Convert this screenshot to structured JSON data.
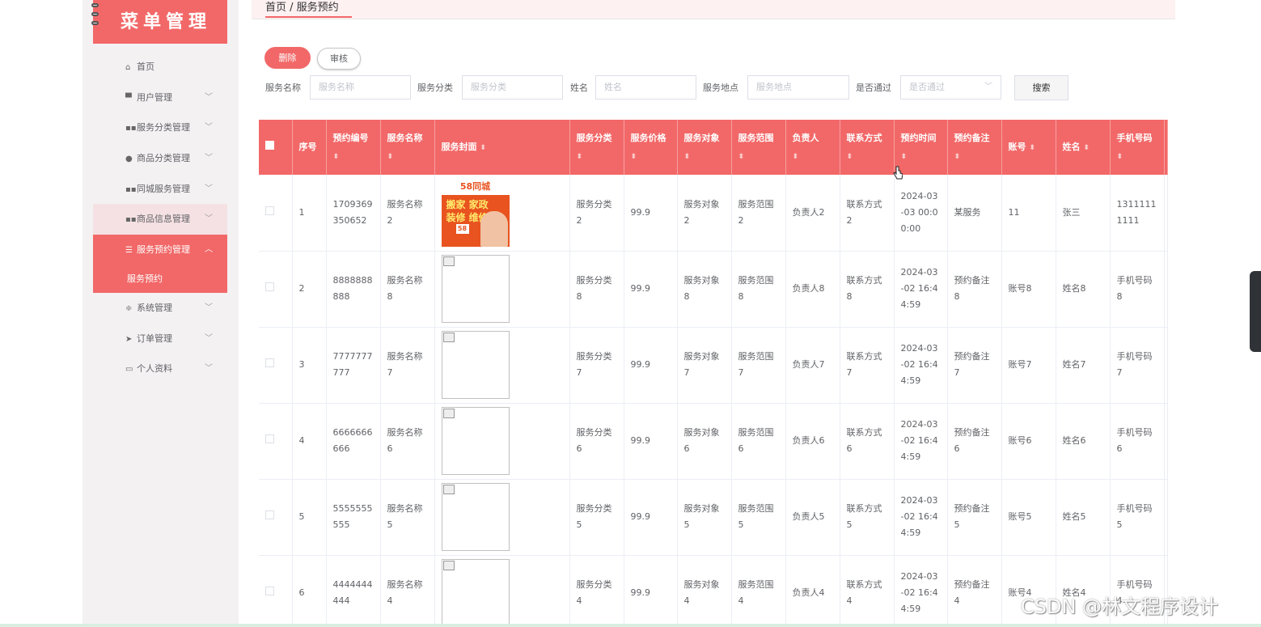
{
  "sidebar": {
    "logo_text": "菜单管理",
    "items": [
      {
        "label": "首页",
        "icon": "home-icon",
        "has_chevron": false
      },
      {
        "label": "用户管理",
        "icon": "monitor-icon",
        "has_chevron": true
      },
      {
        "label": "服务分类管理",
        "icon": "grid-icon",
        "has_chevron": true
      },
      {
        "label": "商品分类管理",
        "icon": "user-icon",
        "has_chevron": true
      },
      {
        "label": "同城服务管理",
        "icon": "grid-icon",
        "has_chevron": true
      },
      {
        "label": "商品信息管理",
        "icon": "grid-icon",
        "has_chevron": true
      },
      {
        "label": "服务预约管理",
        "icon": "list-icon",
        "has_chevron": true
      },
      {
        "label": "系统管理",
        "icon": "sliders-icon",
        "has_chevron": true
      },
      {
        "label": "订单管理",
        "icon": "send-icon",
        "has_chevron": true
      },
      {
        "label": "个人资料",
        "icon": "card-icon",
        "has_chevron": true
      }
    ],
    "sub_item": "服务预约"
  },
  "breadcrumb": "首页 / 服务预约",
  "actions": {
    "delete": "删除",
    "audit": "审核",
    "search": "搜索"
  },
  "filters": {
    "service_name": {
      "label": "服务名称",
      "placeholder": "服务名称"
    },
    "service_category": {
      "label": "服务分类",
      "placeholder": "服务分类"
    },
    "name": {
      "label": "姓名",
      "placeholder": "姓名"
    },
    "service_location": {
      "label": "服务地点",
      "placeholder": "服务地点"
    },
    "approved": {
      "label": "是否通过",
      "placeholder": "是否通过"
    }
  },
  "table": {
    "columns": [
      "序号",
      "预约编号",
      "服务名称",
      "服务封面",
      "服务分类",
      "服务价格",
      "服务对象",
      "服务范围",
      "负责人",
      "联系方式",
      "预约时间",
      "预约备注",
      "账号",
      "姓名",
      "手机号码"
    ],
    "rows": [
      {
        "index": "1",
        "booking_no": "1709369350652",
        "service_name": "服务名称2",
        "cover": "58同城 搬家 家政 装修 维修",
        "category": "服务分类2",
        "price": "99.9",
        "target": "服务对象2",
        "scope": "服务范围2",
        "manager": "负责人2",
        "contact": "联系方式2",
        "time": "2024-03-03 00:00:00",
        "remark": "某服务",
        "account": "11",
        "name": "张三",
        "phone": "13111111111"
      },
      {
        "index": "2",
        "booking_no": "8888888888",
        "service_name": "服务名称8",
        "cover": "",
        "category": "服务分类8",
        "price": "99.9",
        "target": "服务对象8",
        "scope": "服务范围8",
        "manager": "负责人8",
        "contact": "联系方式8",
        "time": "2024-03-02 16:44:59",
        "remark": "预约备注8",
        "account": "账号8",
        "name": "姓名8",
        "phone": "手机号码8"
      },
      {
        "index": "3",
        "booking_no": "7777777777",
        "service_name": "服务名称7",
        "cover": "",
        "category": "服务分类7",
        "price": "99.9",
        "target": "服务对象7",
        "scope": "服务范围7",
        "manager": "负责人7",
        "contact": "联系方式7",
        "time": "2024-03-02 16:44:59",
        "remark": "预约备注7",
        "account": "账号7",
        "name": "姓名7",
        "phone": "手机号码7"
      },
      {
        "index": "4",
        "booking_no": "6666666666",
        "service_name": "服务名称6",
        "cover": "",
        "category": "服务分类6",
        "price": "99.9",
        "target": "服务对象6",
        "scope": "服务范围6",
        "manager": "负责人6",
        "contact": "联系方式6",
        "time": "2024-03-02 16:44:59",
        "remark": "预约备注6",
        "account": "账号6",
        "name": "姓名6",
        "phone": "手机号码6"
      },
      {
        "index": "5",
        "booking_no": "5555555555",
        "service_name": "服务名称5",
        "cover": "",
        "category": "服务分类5",
        "price": "99.9",
        "target": "服务对象5",
        "scope": "服务范围5",
        "manager": "负责人5",
        "contact": "联系方式5",
        "time": "2024-03-02 16:44:59",
        "remark": "预约备注5",
        "account": "账号5",
        "name": "姓名5",
        "phone": "手机号码5"
      },
      {
        "index": "6",
        "booking_no": "4444444444",
        "service_name": "服务名称4",
        "cover": "",
        "category": "服务分类4",
        "price": "99.9",
        "target": "服务对象4",
        "scope": "服务范围4",
        "manager": "负责人4",
        "contact": "联系方式4",
        "time": "2024-03-02 16:44:59",
        "remark": "预约备注4",
        "account": "账号4",
        "name": "姓名4",
        "phone": "手机号码4"
      }
    ]
  },
  "watermark": "CSDN @林文程序设计",
  "colors": {
    "accent": "#f26868",
    "sidebar_bg": "#f4f1f3"
  }
}
